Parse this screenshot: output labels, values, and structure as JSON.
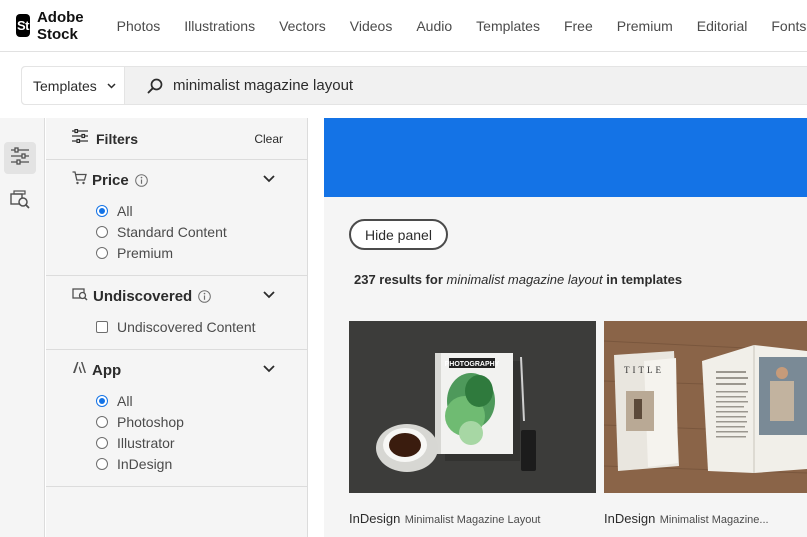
{
  "brand": {
    "mark": "St",
    "name": "Adobe Stock"
  },
  "nav": [
    "Photos",
    "Illustrations",
    "Vectors",
    "Videos",
    "Audio",
    "Templates",
    "Free",
    "Premium",
    "Editorial",
    "Fonts"
  ],
  "search": {
    "type": "Templates",
    "query": "minimalist magazine layout"
  },
  "filters": {
    "title": "Filters",
    "clear": "Clear",
    "price": {
      "title": "Price",
      "options": [
        "All",
        "Standard Content",
        "Premium"
      ],
      "selected": "All"
    },
    "undiscovered": {
      "title": "Undiscovered",
      "options": [
        "Undiscovered Content"
      ]
    },
    "app": {
      "title": "App",
      "options": [
        "All",
        "Photoshop",
        "Illustrator",
        "InDesign"
      ],
      "selected": "All"
    }
  },
  "main": {
    "hide_panel": "Hide panel",
    "results": {
      "count": "237 results for",
      "query": "minimalist magazine layout",
      "suffix": "in templates"
    },
    "cards": [
      {
        "app": "InDesign",
        "name": "Minimalist Magazine Layout",
        "cover_text": "PHOTOGRAPHY"
      },
      {
        "app": "InDesign",
        "name": "Minimalist Magazine...",
        "cover_text": "TITLE"
      }
    ]
  },
  "colors": {
    "accent": "#1473e6",
    "text": "#2c2c2c",
    "panel": "#f5f5f5"
  }
}
